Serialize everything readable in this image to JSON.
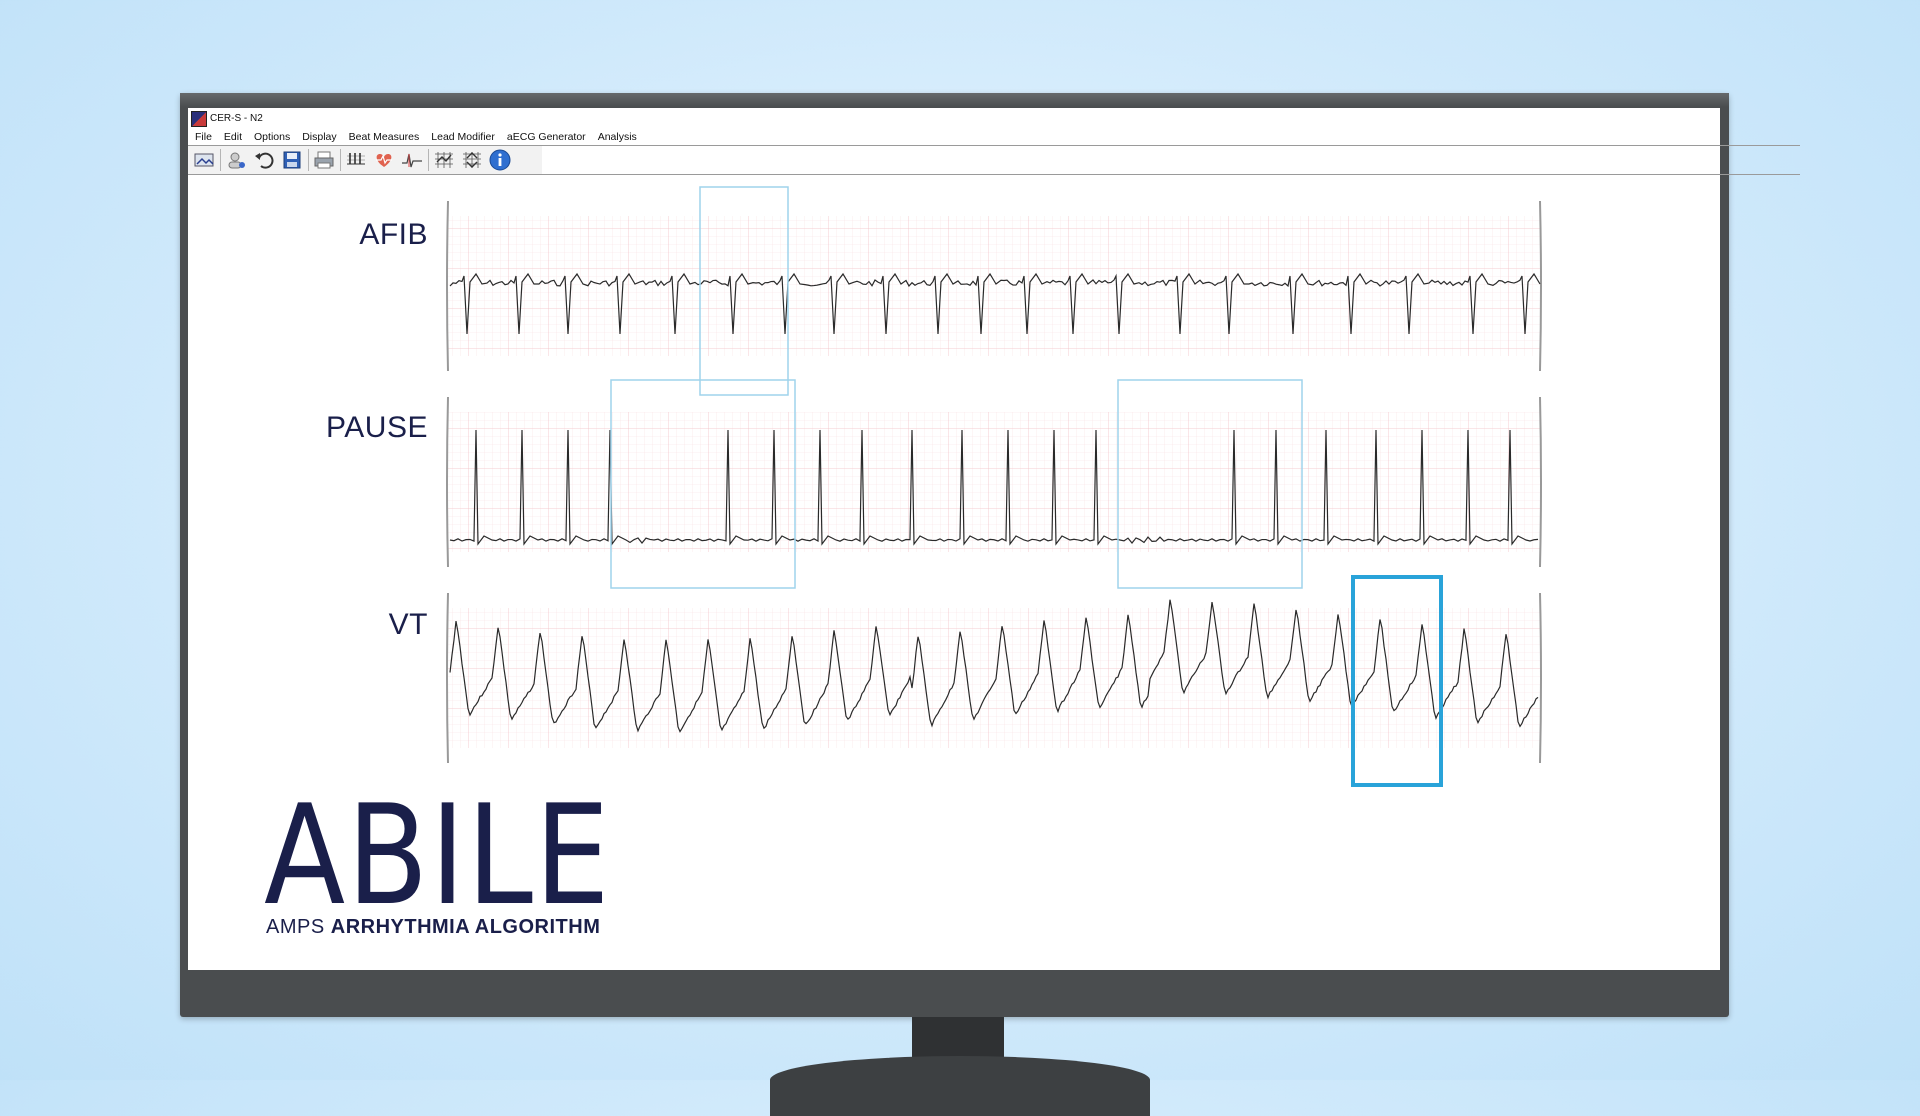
{
  "window": {
    "title": "CER-S - N2"
  },
  "menu": [
    "File",
    "Edit",
    "Options",
    "Display",
    "Beat Measures",
    "Lead Modifier",
    "aECG Generator",
    "Analysis"
  ],
  "toolbar": [
    "open-icon",
    "user-info-icon",
    "undo-icon",
    "save-icon",
    "print-icon",
    "beat-grid-icon",
    "heart-icon",
    "waveform-icon",
    "grid-zoom-icon",
    "grid-pan-icon",
    "info-icon"
  ],
  "leads": [
    {
      "label": "AFIB"
    },
    {
      "label": "PAUSE"
    },
    {
      "label": "VT"
    }
  ],
  "logo": {
    "main": "ABILE",
    "sub_regular": "AMPS",
    "sub_bold": "ARRHYTHMIA ALGORITHM"
  },
  "colors": {
    "highlight": "#29a3d9",
    "highlight_light": "#9fd3ec",
    "grid": "#f7d6d9",
    "trace": "#2a2a2a",
    "brand": "#1a1f4a"
  }
}
